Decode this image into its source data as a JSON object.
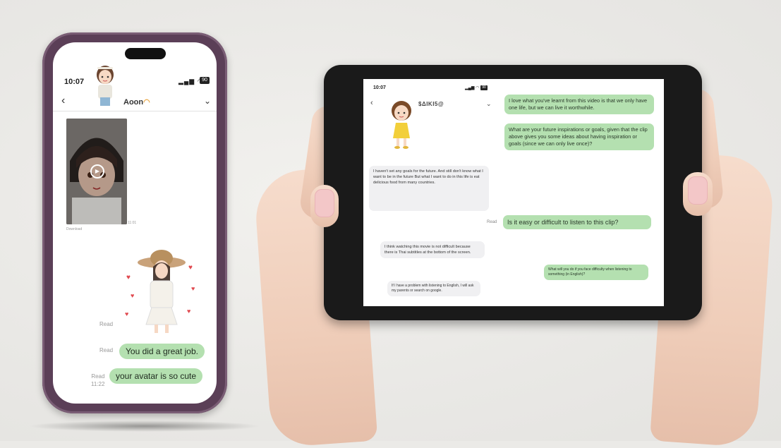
{
  "phone": {
    "status": {
      "time": "10:07",
      "battery": "90"
    },
    "header": {
      "contact_name": "Aoon"
    },
    "video": {
      "timestamp": "11:01",
      "download_label": "Download"
    },
    "messages": [
      {
        "status": "Read",
        "type": "sticker"
      },
      {
        "status": "Read",
        "text": "You did a great job."
      },
      {
        "status": "Read",
        "time": "11:22",
        "text": "your avatar is so cute"
      }
    ]
  },
  "tablet": {
    "status": {
      "time": "10:07",
      "battery": "90"
    },
    "header": {
      "contact_name": "$ΔΙΚΙ5@"
    },
    "messages": [
      {
        "side": "right",
        "text": "I love what you've learnt from this video is that we only have one life, but we can live it worthwhile."
      },
      {
        "side": "right",
        "text": "What are your future inspirations or goals, given that the clip above gives you some ideas about having inspiration or goals (since we can only live once)?"
      },
      {
        "side": "left",
        "text": "I haven't set any goals for the future. And still don't know what I want to be in the future But what I want to do in this life is eat delicious food from many countries."
      },
      {
        "side": "right",
        "status": "Read",
        "text": "Is it easy or difficult to listen to this clip?"
      },
      {
        "side": "left",
        "text": "I think watching this movie is not difficult because there is Thai subtitles at the bottom of the screen."
      },
      {
        "side": "right",
        "text": "What will you do if you face difficulty when listening to something (in English)?"
      },
      {
        "side": "left",
        "text": "If I have a problem with listening to English, I will ask my parents or search on google."
      }
    ]
  },
  "colors": {
    "sent_bubble": "#b4e0b0",
    "received_bubble": "#f0f0f2",
    "phone_frame": "#5b3f57",
    "background": "#ebeae7"
  }
}
